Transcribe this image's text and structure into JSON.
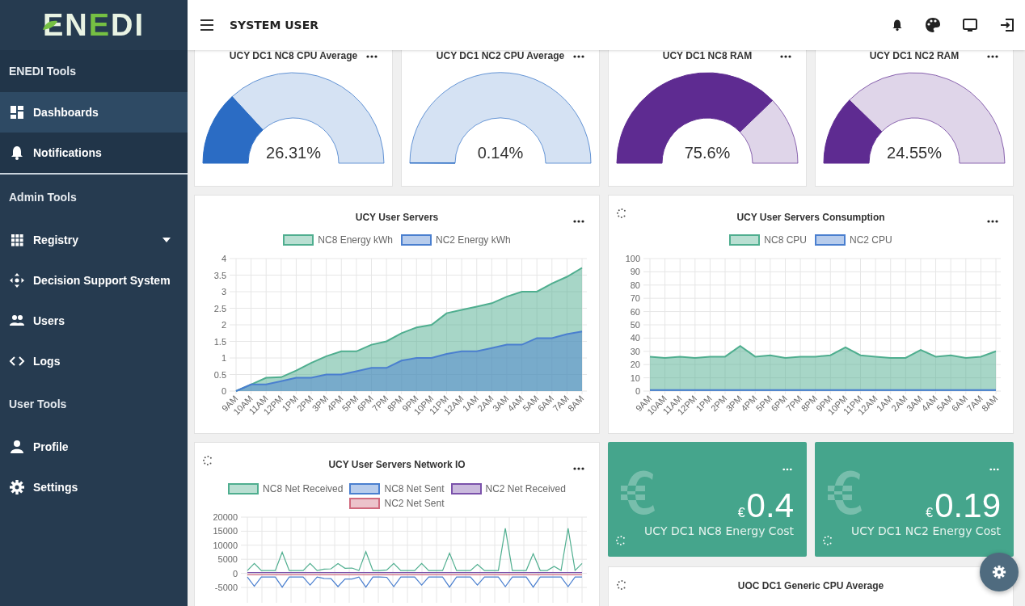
{
  "logo": {
    "parts": [
      {
        "text": "EN",
        "color": "#e9f3e3"
      },
      {
        "text": "E",
        "color": "#76c043"
      },
      {
        "text": "DI",
        "color": "#e9f3e3"
      }
    ]
  },
  "sidebar": {
    "sections": [
      {
        "title": "ENEDI Tools",
        "items": [
          {
            "label": "Dashboards",
            "kind": "dashboard",
            "selected": true,
            "has_submenu": false
          },
          {
            "label": "Notifications",
            "kind": "bell",
            "selected": false,
            "has_submenu": false
          }
        ]
      },
      {
        "title": "Admin Tools",
        "items": [
          {
            "label": "Registry",
            "kind": "grid",
            "selected": false,
            "has_submenu": true
          },
          {
            "label": "Decision Support System",
            "kind": "move",
            "selected": false,
            "has_submenu": false
          },
          {
            "label": "Users",
            "kind": "users",
            "selected": false,
            "has_submenu": false
          },
          {
            "label": "Logs",
            "kind": "code",
            "selected": false,
            "has_submenu": false
          }
        ]
      },
      {
        "title": "User Tools",
        "items": [
          {
            "label": "Profile",
            "kind": "person",
            "selected": false,
            "has_submenu": false
          },
          {
            "label": "Settings",
            "kind": "gear",
            "selected": false,
            "has_submenu": false
          }
        ]
      }
    ]
  },
  "topbar": {
    "title": "SYSTEM USER"
  },
  "gauges": [
    {
      "title": "UCY DC1 NC8 CPU Average",
      "value": "26.31%",
      "color": "#2b6cc4",
      "chart_data": {
        "type": "donut",
        "values": [
          26.31,
          73.69
        ]
      }
    },
    {
      "title": "UCY DC1 NC2 CPU Average",
      "value": "0.14%",
      "color": "#2b6cc4",
      "chart_data": {
        "type": "donut",
        "values": [
          0.14,
          99.86
        ]
      }
    },
    {
      "title": "UCY DC1 NC8 RAM",
      "value": "75.6%",
      "color": "#5e2b91",
      "chart_data": {
        "type": "donut",
        "values": [
          75.6,
          24.4
        ]
      }
    },
    {
      "title": "UCY DC1 NC2 RAM",
      "value": "24.55%",
      "color": "#5e2b91",
      "chart_data": {
        "type": "donut",
        "values": [
          24.55,
          75.45
        ]
      }
    }
  ],
  "charts": [
    {
      "loading": false,
      "chart_data": {
        "type": "area",
        "grid": true,
        "title": "UCY User Servers",
        "categories": [
          "9AM",
          "10AM",
          "11AM",
          "12PM",
          "1PM",
          "2PM",
          "3PM",
          "4PM",
          "5PM",
          "6PM",
          "7PM",
          "8PM",
          "9PM",
          "10PM",
          "11PM",
          "12AM",
          "1AM",
          "2AM",
          "3AM",
          "4AM",
          "5AM",
          "6AM",
          "7AM",
          "8AM"
        ],
        "ylim": [
          0,
          4
        ],
        "yticks": [
          0,
          0.5,
          1,
          1.5,
          2,
          2.5,
          3,
          3.5,
          4
        ],
        "series": [
          {
            "name": "NC8 Energy kWh",
            "color": "#4fae8f",
            "values": [
              0,
              0.2,
              0.4,
              0.42,
              0.62,
              0.85,
              1.05,
              1.2,
              1.2,
              1.4,
              1.5,
              1.75,
              1.92,
              2.0,
              2.35,
              2.45,
              2.55,
              2.65,
              2.85,
              3.0,
              3.0,
              3.25,
              3.45,
              3.72
            ]
          },
          {
            "name": "NC2 Energy kWh",
            "color": "#4a7fcf",
            "values": [
              0,
              0.2,
              0.2,
              0.3,
              0.4,
              0.4,
              0.5,
              0.5,
              0.6,
              0.7,
              0.7,
              0.92,
              1.0,
              1.0,
              1.12,
              1.2,
              1.2,
              1.3,
              1.4,
              1.4,
              1.6,
              1.6,
              1.72,
              1.8
            ]
          }
        ]
      }
    },
    {
      "loading": true,
      "chart_data": {
        "type": "area",
        "grid": true,
        "title": "UCY User Servers Consumption",
        "categories": [
          "9AM",
          "10AM",
          "11AM",
          "12PM",
          "1PM",
          "2PM",
          "3PM",
          "4PM",
          "5PM",
          "6PM",
          "7PM",
          "8PM",
          "9PM",
          "10PM",
          "11PM",
          "12AM",
          "1AM",
          "2AM",
          "3AM",
          "4AM",
          "5AM",
          "6AM",
          "7AM",
          "8AM"
        ],
        "ylim": [
          0,
          100
        ],
        "yticks": [
          0,
          10,
          20,
          30,
          40,
          50,
          60,
          70,
          80,
          90,
          100
        ],
        "series": [
          {
            "name": "NC8 CPU",
            "color": "#4fae8f",
            "values": [
              26,
              25,
              26,
              25,
              26,
              26,
              34,
              26,
              27,
              25,
              26,
              26,
              27,
              33,
              27,
              26,
              25,
              25,
              31,
              26,
              27,
              25,
              26,
              30
            ]
          },
          {
            "name": "NC2 CPU",
            "color": "#4a7fcf",
            "values": [
              0.8,
              0.8,
              0.8,
              0.8,
              0.8,
              0.8,
              0.8,
              0.8,
              0.8,
              0.8,
              0.8,
              0.8,
              0.8,
              0.8,
              0.8,
              0.8,
              0.8,
              0.8,
              0.8,
              0.8,
              0.8,
              0.8,
              0.8,
              0.8
            ]
          }
        ]
      }
    }
  ],
  "network": {
    "loading": true,
    "chart_data": {
      "type": "line",
      "grid": true,
      "title": "UCY User Servers Network IO",
      "ylim": [
        -5000,
        20000
      ],
      "yticks": [
        20000,
        15000,
        10000,
        5000,
        0,
        -5000
      ],
      "series": [
        {
          "name": "NC8 Net Received",
          "color": "#4fae8f",
          "values": [
            1000,
            3500,
            1000,
            1000,
            1000,
            7500,
            1000,
            1000,
            1000,
            3500,
            1000,
            1500,
            1600,
            3500,
            1800,
            1900,
            1000,
            7700,
            1000,
            1000,
            1200,
            3500,
            1000,
            1000,
            1000,
            3500,
            1000,
            1000,
            1000,
            7200,
            1000,
            1000,
            1000,
            3200,
            1000,
            1000,
            1000,
            16000,
            1000,
            1000,
            1000,
            7000,
            1000,
            1000,
            2500,
            1000,
            16000,
            1000,
            3500
          ]
        },
        {
          "name": "NC8 Net Sent",
          "color": "#4a7fcf",
          "values": [
            -1300,
            -4600,
            -1300,
            -1300,
            -1300,
            -4900,
            -1300,
            -1300,
            -1300,
            -4200,
            -1300,
            -1800,
            -1900,
            -4700,
            -2000,
            -2000,
            -1300,
            -4900,
            -1300,
            -1300,
            -1400,
            -4700,
            -1300,
            -1300,
            -1300,
            -4200,
            -1300,
            -1300,
            -1300,
            -4900,
            -1300,
            -1300,
            -1300,
            -4200,
            -1300,
            -1300,
            -1300,
            -4700,
            -1300,
            -1300,
            -1300,
            -4900,
            -1300,
            -1300,
            -1300,
            -1300,
            -4700,
            -1300,
            -1300
          ]
        },
        {
          "name": "NC2 Net Received",
          "color": "#7b52ab",
          "values": [
            300,
            300,
            300,
            300,
            300,
            300,
            300,
            300,
            300,
            300,
            300,
            300,
            300,
            300,
            300,
            300,
            300,
            300,
            300,
            300,
            300,
            300,
            300,
            300,
            300,
            300,
            300,
            300,
            300,
            300,
            300,
            300,
            300,
            300,
            300,
            300,
            300,
            300,
            300,
            300,
            300,
            300,
            300,
            300,
            300,
            300,
            300,
            300,
            300
          ]
        },
        {
          "name": "NC2 Net Sent",
          "color": "#d06a7e",
          "values": [
            -500,
            -500,
            -500,
            -500,
            -500,
            -500,
            -500,
            -500,
            -500,
            -500,
            -500,
            -500,
            -500,
            -500,
            -500,
            -500,
            -500,
            -500,
            -500,
            -500,
            -500,
            -500,
            -500,
            -500,
            -500,
            -500,
            -500,
            -500,
            -500,
            -500,
            -500,
            -500,
            -500,
            -500,
            -500,
            -500,
            -500,
            -500,
            -500,
            -500,
            -500,
            -500,
            -500,
            -500,
            -500,
            -500,
            -500,
            -500,
            -500
          ]
        }
      ]
    }
  },
  "cost_tiles": [
    {
      "currency": "€",
      "amount": "0.4",
      "label": "UCY DC1 NC8 Energy Cost",
      "loading": true
    },
    {
      "currency": "€",
      "amount": "0.19",
      "label": "UCY DC1 NC2 Energy Cost",
      "loading": true
    }
  ],
  "bottom_card": {
    "title": "UOC DC1 Generic CPU Average",
    "loading": true
  }
}
